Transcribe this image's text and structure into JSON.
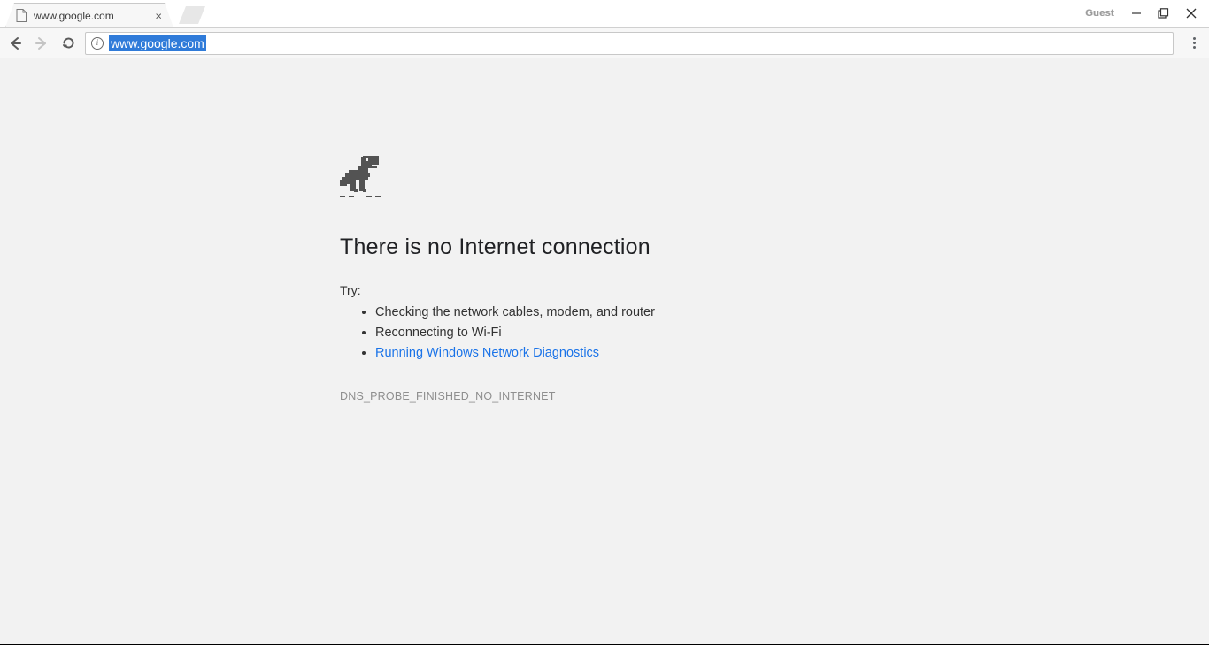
{
  "browser": {
    "tab_title": "www.google.com",
    "guest_label": "Guest",
    "url": "www.google.com"
  },
  "error": {
    "heading": "There is no Internet connection",
    "try_label": "Try:",
    "suggestions": [
      "Checking the network cables, modem, and router",
      "Reconnecting to Wi-Fi",
      "Running Windows Network Diagnostics"
    ],
    "code": "DNS_PROBE_FINISHED_NO_INTERNET"
  }
}
